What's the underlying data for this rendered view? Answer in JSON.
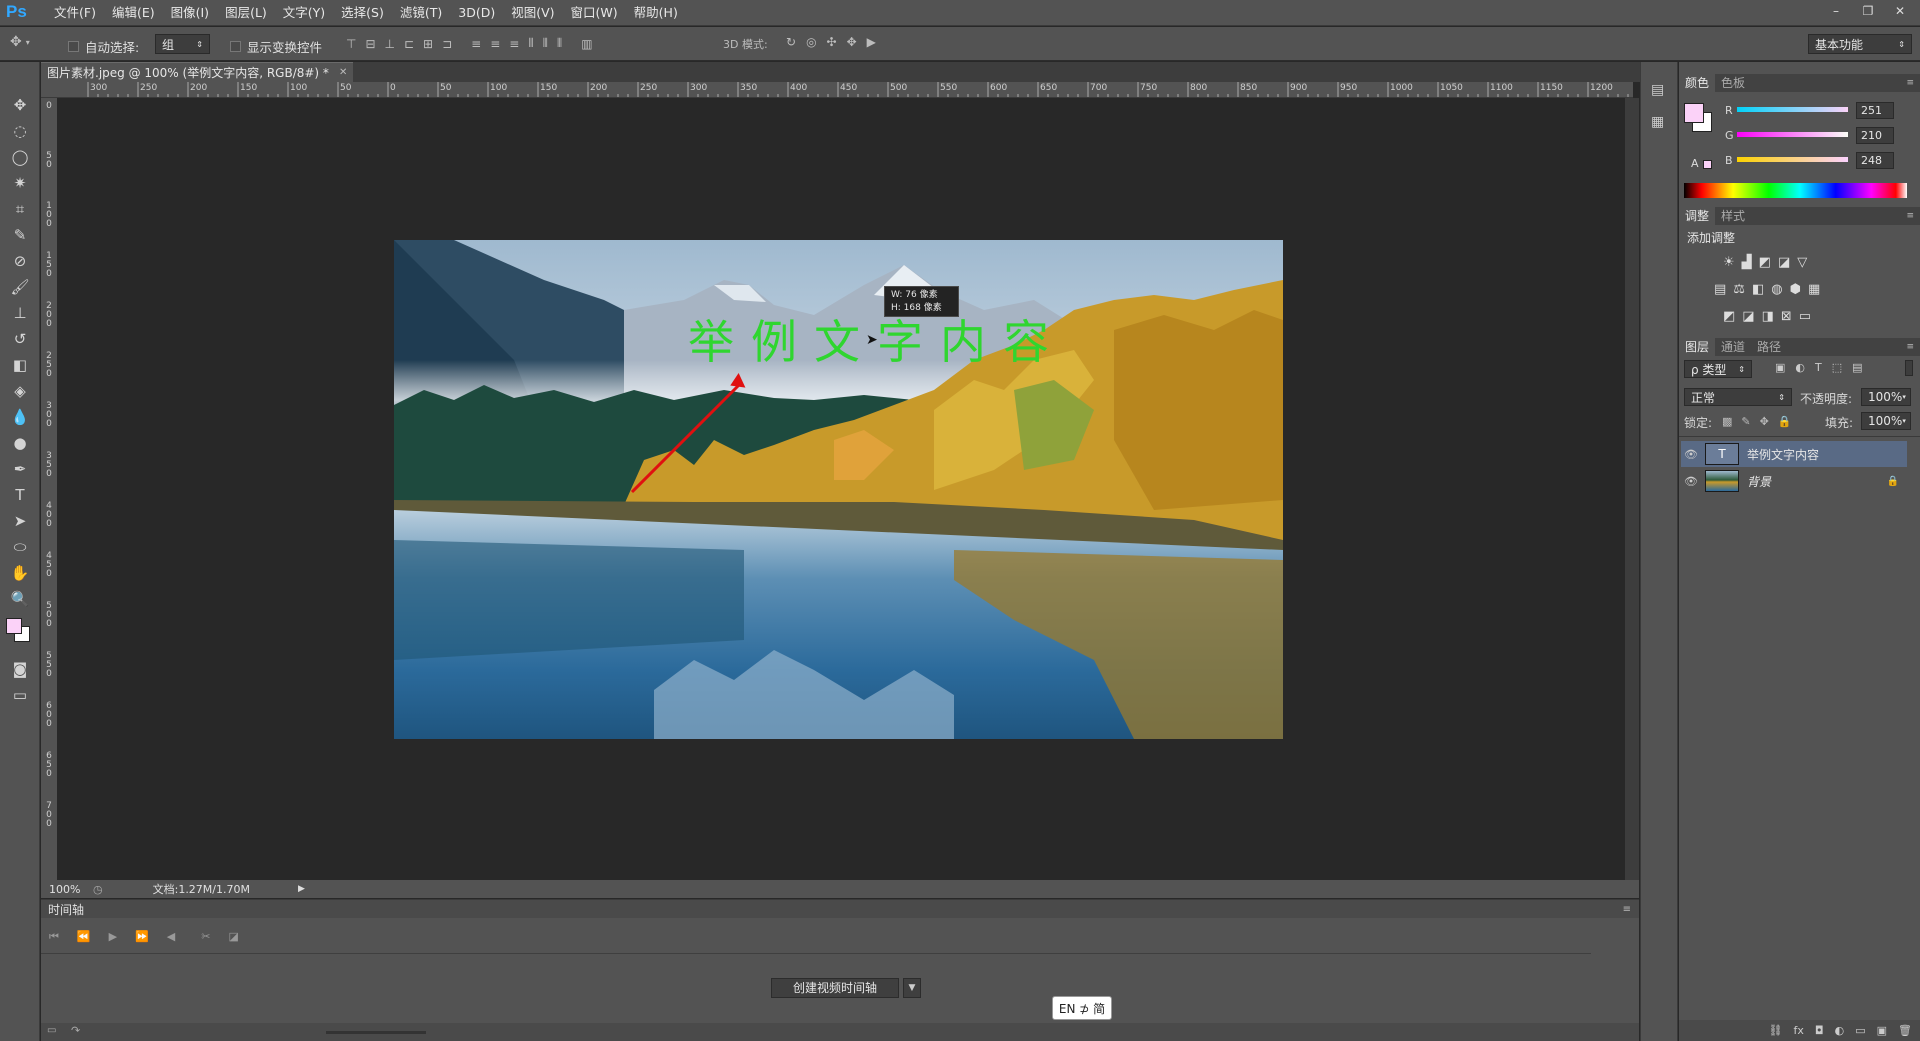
{
  "app": {
    "logo": "Ps"
  },
  "menus": [
    "文件(F)",
    "编辑(E)",
    "图像(I)",
    "图层(L)",
    "文字(Y)",
    "选择(S)",
    "滤镜(T)",
    "3D(D)",
    "视图(V)",
    "窗口(W)",
    "帮助(H)"
  ],
  "window_controls": {
    "minimize": "–",
    "restore": "❐",
    "close": "✕"
  },
  "options": {
    "auto_select_label": "自动选择:",
    "auto_select_value": "组",
    "show_transform_label": "显示变换控件",
    "mode_3d_label": "3D 模式:",
    "workspace": "基本功能"
  },
  "document": {
    "tab_title": "图片素材.jpeg @ 100% (举例文字内容, RGB/8#) *",
    "overlay_text": "举例文字内容",
    "tooltip_w": "W:  76 像素",
    "tooltip_h": "H: 168 像素"
  },
  "ruler_top": [
    "300",
    "250",
    "200",
    "150",
    "100",
    "50",
    "0",
    "50",
    "100",
    "150",
    "200",
    "250",
    "300",
    "350",
    "400",
    "450",
    "500",
    "550",
    "600",
    "650",
    "700",
    "750",
    "800",
    "850",
    "900",
    "950",
    "1000",
    "1050",
    "1100",
    "1150",
    "1200"
  ],
  "ruler_left": [
    "0",
    "50",
    "100",
    "150",
    "200",
    "250",
    "300",
    "350",
    "400",
    "450",
    "500",
    "550",
    "600",
    "650",
    "700"
  ],
  "status": {
    "zoom": "100%",
    "doc_info": "文档:1.27M/1.70M"
  },
  "timeline": {
    "title": "时间轴",
    "create_button": "创建视频时间轴"
  },
  "ime": {
    "text": "EN ⊅ 简"
  },
  "color_panel": {
    "tabs": [
      "颜色",
      "色板"
    ],
    "r_label": "R",
    "r_value": "251",
    "g_label": "G",
    "g_value": "210",
    "b_label": "B",
    "b_value": "248",
    "foreground": "#fbd2f8"
  },
  "adjust_panel": {
    "tabs": [
      "调整",
      "样式"
    ],
    "heading": "添加调整"
  },
  "layers_panel": {
    "tabs": [
      "图层",
      "通道",
      "路径"
    ],
    "filter_label": "ρ 类型",
    "blend_mode": "正常",
    "opacity_label": "不透明度:",
    "opacity_value": "100%",
    "lock_label": "锁定:",
    "fill_label": "填充:",
    "fill_value": "100%",
    "layers": [
      {
        "name": "举例文字内容",
        "type": "text",
        "selected": true
      },
      {
        "name": "背景",
        "type": "image",
        "selected": false
      }
    ]
  },
  "colors": {
    "accent": "#31a8ff",
    "text_green": "#2fd62f",
    "arrow_red": "#e01010",
    "layer_selected": "#596a85"
  }
}
